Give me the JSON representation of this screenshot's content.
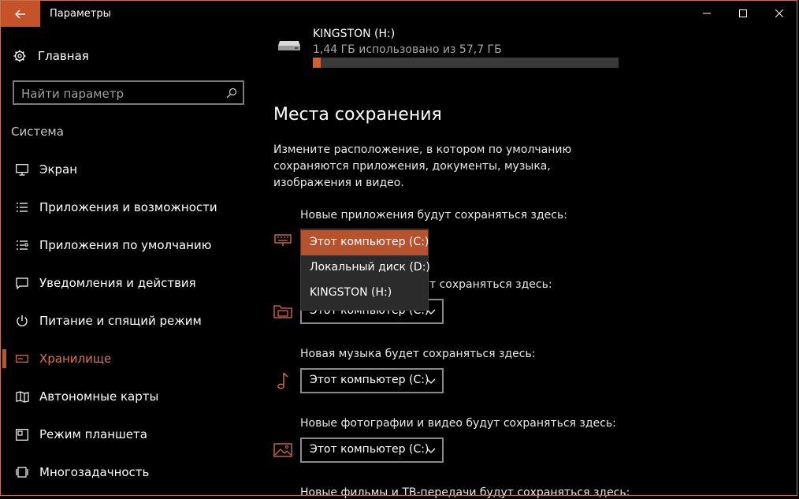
{
  "window": {
    "title": "Параметры"
  },
  "sidebar": {
    "home_label": "Главная",
    "search_placeholder": "Найти параметр",
    "section_title": "Система",
    "items": [
      {
        "label": "Экран",
        "icon": "monitor-icon"
      },
      {
        "label": "Приложения и возможности",
        "icon": "list-icon"
      },
      {
        "label": "Приложения по умолчанию",
        "icon": "list-check-icon"
      },
      {
        "label": "Уведомления и действия",
        "icon": "message-icon"
      },
      {
        "label": "Питание и спящий режим",
        "icon": "power-icon"
      },
      {
        "label": "Хранилище",
        "icon": "storage-icon",
        "active": true
      },
      {
        "label": "Автономные карты",
        "icon": "map-icon"
      },
      {
        "label": "Режим планшета",
        "icon": "tablet-icon"
      },
      {
        "label": "Многозадачность",
        "icon": "multitask-icon"
      }
    ]
  },
  "main": {
    "drive": {
      "name": "KINGSTON (H:)",
      "usage_text": "1,44 ГБ использовано из 57,7 ГБ",
      "used_fraction": 0.025
    },
    "heading": "Места сохранения",
    "description": "Измените расположение, в котором по умолчанию сохраняются приложения, документы, музыка, изображения и видео.",
    "locations": [
      {
        "label": "Новые приложения будут сохраняться здесь:",
        "value": "Этот компьютер (C:)",
        "icon": "keyboard-icon"
      },
      {
        "label": "Новые документы будут сохраняться здесь:",
        "visible_label": "т сохраняться здесь:",
        "value": "Этот компьютер (C:)",
        "icon": "folder-icon"
      },
      {
        "label": "Новая музыка будет сохраняться здесь:",
        "value": "Этот компьютер (C:)",
        "icon": "music-note-icon"
      },
      {
        "label": "Новые фотографии и видео будут сохраняться здесь:",
        "value": "Этот компьютер (C:)",
        "icon": "image-icon"
      },
      {
        "label": "Новые фильмы и ТВ-передачи будут сохраняться здесь:",
        "icon": "film-icon"
      }
    ],
    "dropdown_options": [
      "Этот компьютер (C:)",
      "Локальный диск (D:)",
      "KINGSTON (H:)"
    ],
    "dropdown_selected": 0
  },
  "colors": {
    "accent": "#c5532a",
    "accent_text": "#e0724c",
    "background": "#000000"
  }
}
